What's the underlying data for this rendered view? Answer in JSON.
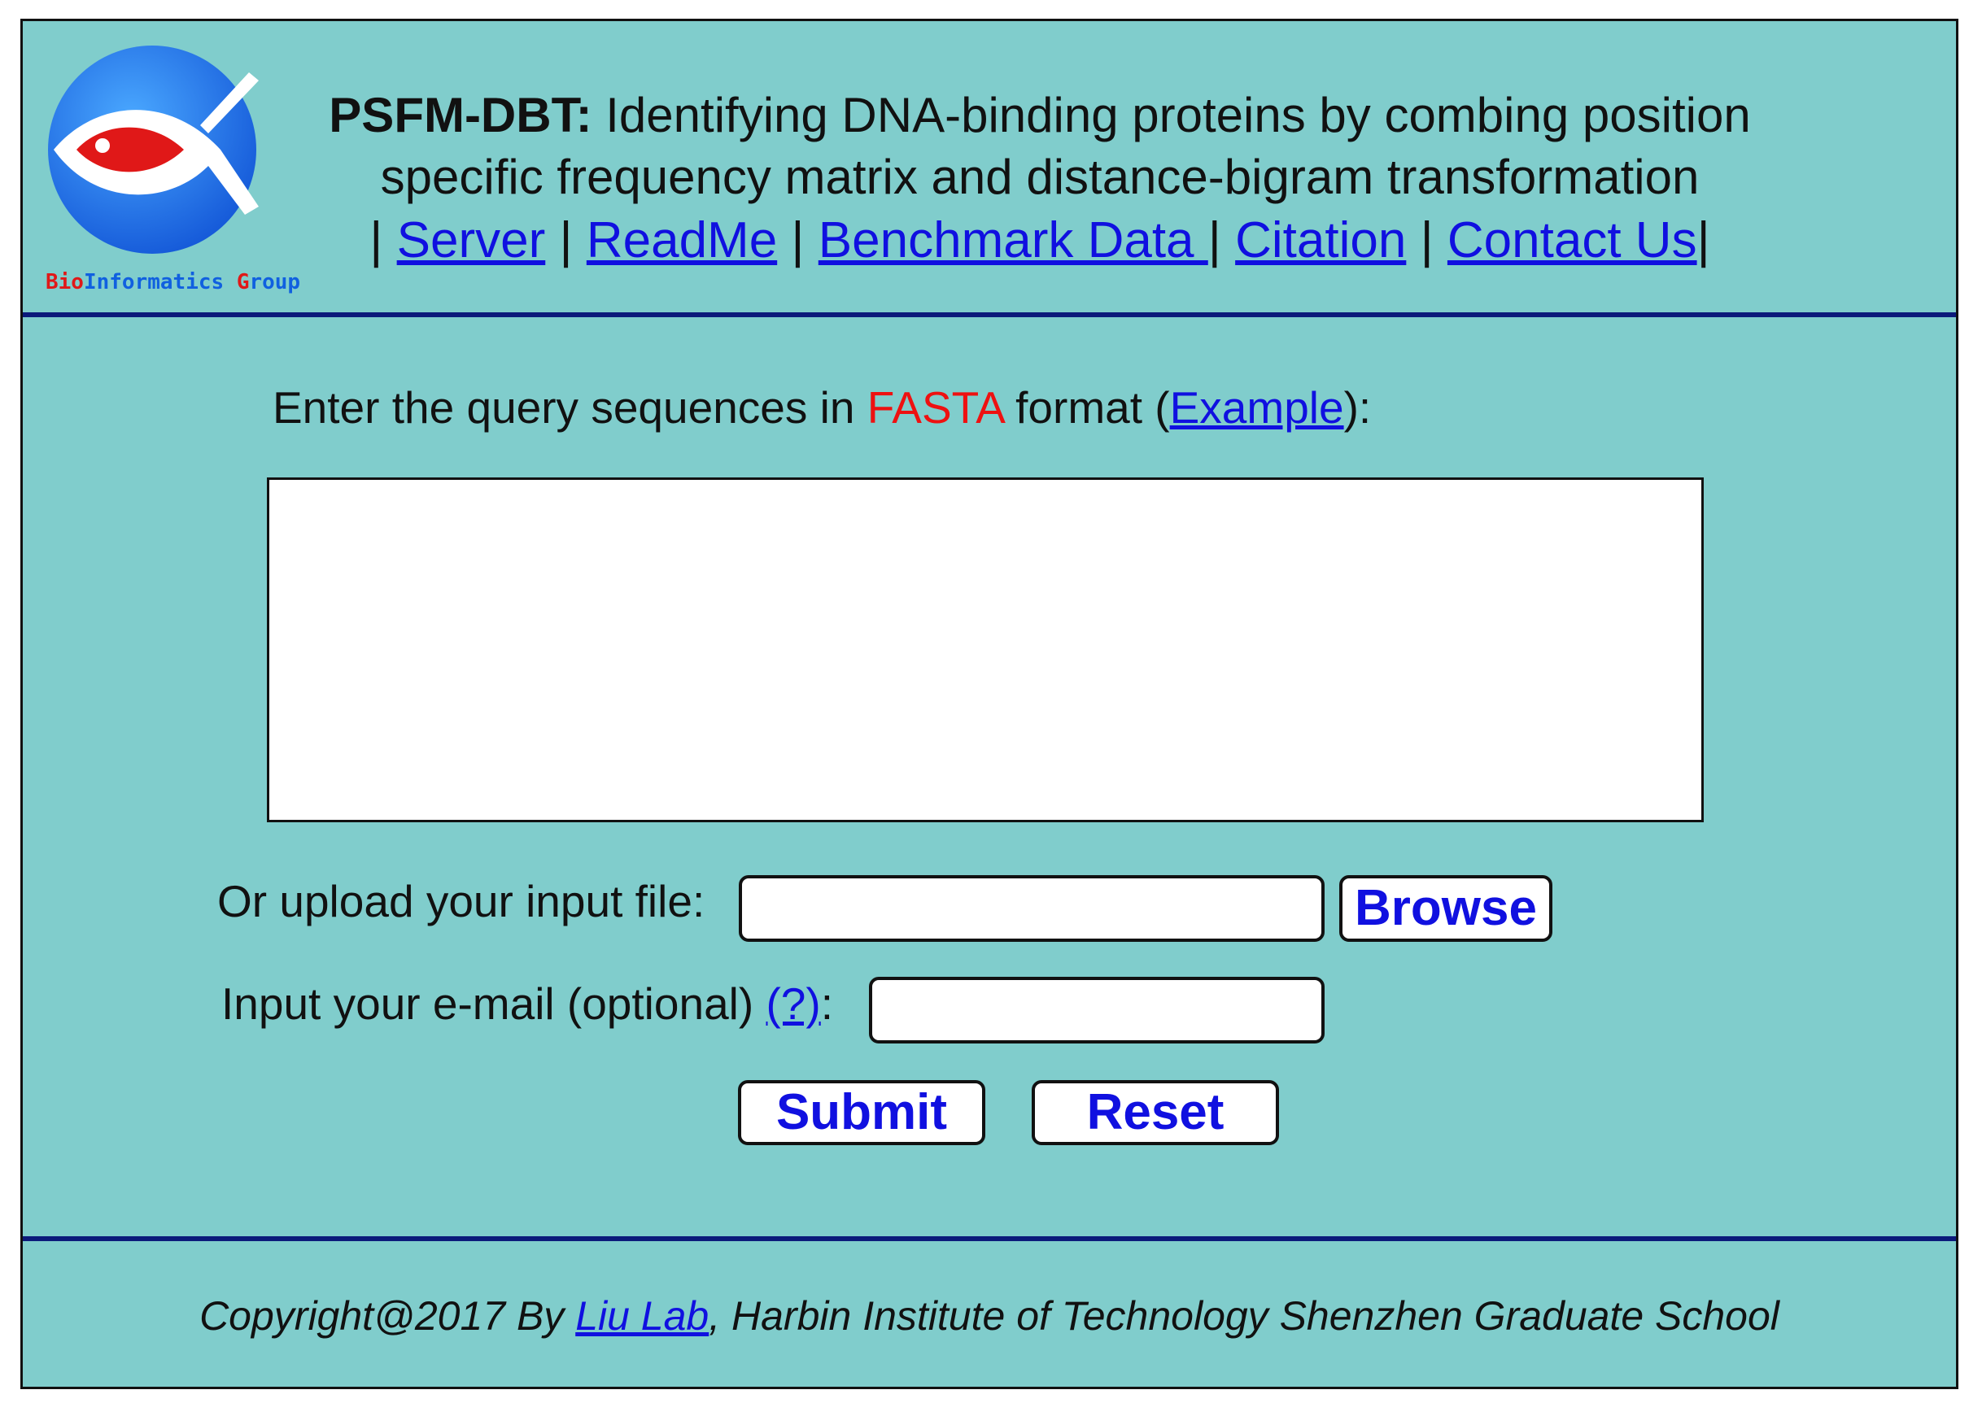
{
  "header": {
    "logo_text_red": "Bio",
    "logo_text_blue": "Informatics ",
    "logo_text_red2": "G",
    "logo_text_blue2": "roup",
    "title_brand": "PSFM-DBT:",
    "title_line1": "Identifying DNA-binding proteins by combing position",
    "title_line2": "specific frequency matrix and distance-bigram transformation",
    "nav": {
      "sep": "|",
      "server": "Server",
      "readme": "ReadMe",
      "benchmark": "Benchmark Data ",
      "citation": "Citation",
      "contact": "Contact Us"
    }
  },
  "form": {
    "prompt_before": "Enter the query sequences in ",
    "prompt_fasta": "FASTA",
    "prompt_middle": " format (",
    "prompt_example": "Example",
    "prompt_after": "):",
    "sequence_value": "",
    "upload_label": "Or upload your input file:",
    "upload_value": "",
    "browse_label": "Browse",
    "email_label_before": "Input your e-mail (optional) ",
    "email_help": "(?)",
    "email_label_after": ":",
    "email_value": "",
    "submit_label": "Submit",
    "reset_label": "Reset"
  },
  "footer": {
    "before": "Copyright@2017 By ",
    "lab": "Liu Lab",
    "after": ", Harbin Institute of Technology Shenzhen Graduate School"
  },
  "colors": {
    "background": "#80cdcc",
    "rule": "#0b1a7a",
    "link": "#1010e0",
    "fasta": "#ee1111",
    "logo_blue": "#1a6fe8",
    "logo_red": "#e01818"
  },
  "icons": {
    "logo": "fish-globe-logo-icon"
  }
}
